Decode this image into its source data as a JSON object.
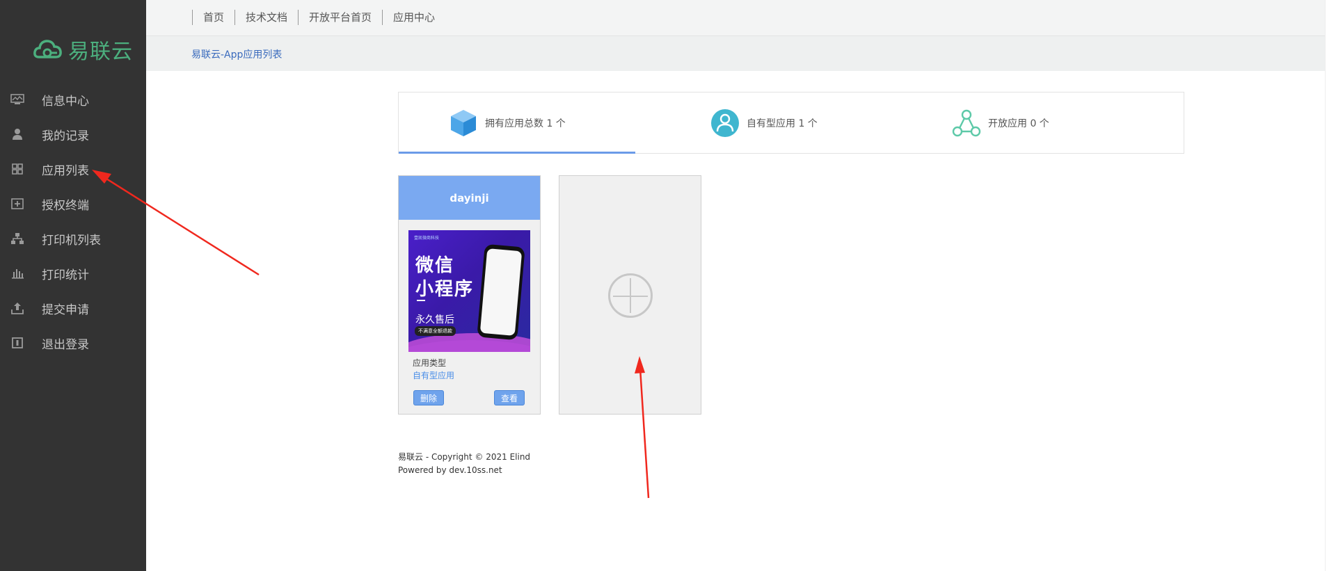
{
  "brand": {
    "logo_text": "易联云",
    "accent": "#4caf7e"
  },
  "sidebar": {
    "items": [
      {
        "label": "信息中心",
        "icon": "monitor-icon"
      },
      {
        "label": "我的记录",
        "icon": "user-icon"
      },
      {
        "label": "应用列表",
        "icon": "grid-icon"
      },
      {
        "label": "授权终端",
        "icon": "plus-box-icon"
      },
      {
        "label": "打印机列表",
        "icon": "network-icon"
      },
      {
        "label": "打印统计",
        "icon": "bar-chart-icon"
      },
      {
        "label": "提交申请",
        "icon": "upload-icon"
      },
      {
        "label": "退出登录",
        "icon": "logout-icon"
      }
    ]
  },
  "topnav": {
    "items": [
      "首页",
      "技术文档",
      "开放平台首页",
      "应用中心"
    ]
  },
  "breadcrumb": "易联云-App应用列表",
  "stats": [
    {
      "label": "拥有应用总数 1 个",
      "icon": "cube-icon"
    },
    {
      "label": "自有型应用 1 个",
      "icon": "person-circle-icon"
    },
    {
      "label": "开放应用 0 个",
      "icon": "share-nodes-icon"
    }
  ],
  "app_card": {
    "title": "dayinji",
    "image": {
      "tag": "壹凯微商科技",
      "line1": "微信",
      "line2": "小程序",
      "line3": "永久售后",
      "pill": "不满意全额退款"
    },
    "type_label": "应用类型",
    "type_value": "自有型应用",
    "delete_label": "删除",
    "view_label": "查看"
  },
  "footer": {
    "line1": "易联云 - Copyright © 2021 Elind",
    "line2": "Powered by dev.10ss.net"
  }
}
